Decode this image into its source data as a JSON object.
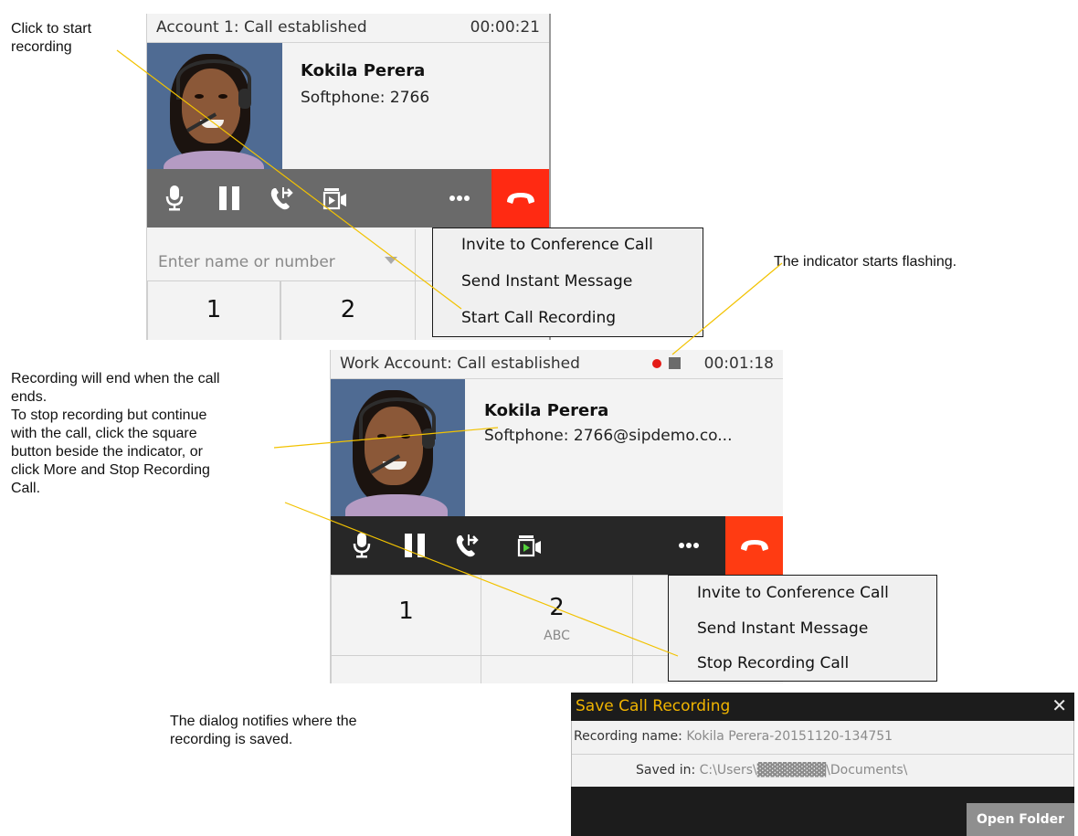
{
  "annotations": {
    "click_to_start": "Click to start\nrecording",
    "indicator_flashing": "The indicator starts flashing.",
    "recording_end": "Recording will end when the call\nends.\nTo stop recording but continue\nwith the call, click the square\nbutton beside the indicator, or\nclick More and Stop Recording\nCall.",
    "dialog_notifies": "The dialog notifies where the\nrecording is saved."
  },
  "window1": {
    "title": "Account 1: Call established",
    "timer": "00:00:21",
    "caller_name": "Kokila Perera",
    "caller_number": "Softphone: 2766",
    "entry_placeholder": "Enter name or number",
    "keys": [
      {
        "digit": "1",
        "letters": ""
      },
      {
        "digit": "2",
        "letters": ""
      }
    ],
    "menu": [
      "Invite to Conference Call",
      "Send Instant Message",
      "Start Call Recording"
    ]
  },
  "window2": {
    "title": "Work Account: Call established",
    "timer": "00:01:18",
    "caller_name": "Kokila Perera",
    "caller_number": "Softphone: 2766@sipdemo.co...",
    "keys": [
      {
        "digit": "1",
        "letters": ""
      },
      {
        "digit": "2",
        "letters": "ABC"
      }
    ],
    "menu": [
      "Invite to Conference Call",
      "Send Instant Message",
      "Stop Recording Call"
    ]
  },
  "dialog": {
    "title": "Save Call Recording",
    "close": "✕",
    "recording_name_label": "Recording name:",
    "recording_name_value": "Kokila Perera-20151120-134751",
    "saved_in_label": "Saved in:",
    "saved_in_value": "C:\\Users\\▓▓▓▓▓▓▓\\Documents\\",
    "open_folder": "Open Folder"
  },
  "icons": {
    "mic": "mic-icon",
    "pause": "pause-icon",
    "transfer": "transfer-icon",
    "video": "video-icon",
    "more": "more-icon",
    "hangup": "hangup-icon",
    "record_indicator": "record-indicator-icon",
    "stop_record": "stop-recording-icon"
  },
  "colors": {
    "hangup_red": "#ff2a12",
    "record_red": "#e41b17",
    "dialog_title": "#f0b400",
    "leader_line": "#f2c200"
  }
}
